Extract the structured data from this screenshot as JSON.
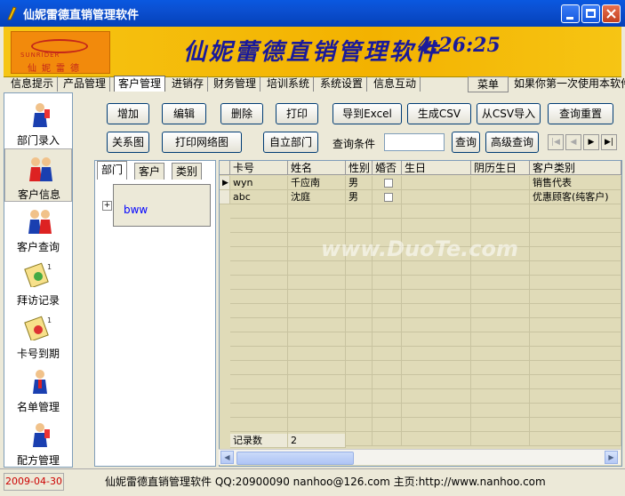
{
  "window": {
    "title": "仙妮雷德直销管理软件"
  },
  "banner": {
    "brand_en": "SUNRIDER",
    "brand_cn": "仙妮雷德",
    "title": "仙妮蕾德直销管理软件",
    "clock": "4:26:25"
  },
  "tabs": [
    "信息提示",
    "产品管理",
    "客户管理",
    "进销存",
    "财务管理",
    "培训系统",
    "系统设置",
    "信息互动"
  ],
  "active_tab": "客户管理",
  "menu_button": "菜单",
  "marquee": "如果你第一次使用本软件",
  "nav": [
    {
      "label": "部门录入",
      "icon": "department-icon"
    },
    {
      "label": "客户信息",
      "icon": "customer-info-icon"
    },
    {
      "label": "客户查询",
      "icon": "customer-query-icon"
    },
    {
      "label": "拜访记录",
      "icon": "visit-record-icon"
    },
    {
      "label": "卡号到期",
      "icon": "card-expiry-icon"
    },
    {
      "label": "名单管理",
      "icon": "list-manage-icon"
    },
    {
      "label": "配方管理",
      "icon": "formula-manage-icon"
    }
  ],
  "toolbar": {
    "add": "增加",
    "edit": "编辑",
    "delete": "删除",
    "print": "打印",
    "export_excel": "导到Excel",
    "make_csv": "生成CSV",
    "import_csv": "从CSV导入",
    "reset_query": "查询重置",
    "relation_chart": "关系图",
    "print_network": "打印网络图",
    "own_department": "自立部门",
    "query_condition": "查询条件",
    "query_value": "",
    "query": "查询",
    "advanced_query": "高级查询"
  },
  "tree": {
    "tabs": [
      "部门",
      "客户",
      "类别"
    ],
    "node": "bww"
  },
  "grid": {
    "columns": [
      "卡号",
      "姓名",
      "性别",
      "婚否",
      "生日",
      "阴历生日",
      "客户类别"
    ],
    "rows": [
      {
        "card": "wyn",
        "name": "千应南",
        "gender": "男",
        "married": false,
        "birthday": "",
        "lunar": "",
        "type": "销售代表"
      },
      {
        "card": "abc",
        "name": "沈庭",
        "gender": "男",
        "married": false,
        "birthday": "",
        "lunar": "",
        "type": "优惠顾客(纯客户)"
      }
    ],
    "footer_label": "记录数",
    "footer_count": "2"
  },
  "watermark": "www.DuoTe.com",
  "status": {
    "date": "2009-04-30",
    "info": "仙妮雷德直销管理软件 QQ:20900090 nanhoo@126.com 主页:http://www.nanhoo.com"
  },
  "colors": {
    "title_bar": "#0a58e0",
    "banner": "#f3b200",
    "banner_text": "#1a1a9a",
    "grid_bg": "#e0dbb8",
    "date_text": "#cc0000"
  }
}
